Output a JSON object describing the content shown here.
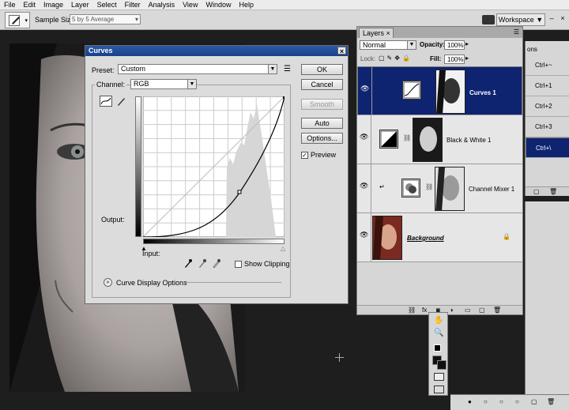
{
  "menu": [
    "File",
    "Edit",
    "Image",
    "Layer",
    "Select",
    "Filter",
    "Analysis",
    "View",
    "Window",
    "Help"
  ],
  "options_bar": {
    "sample_size_label": "Sample Size:",
    "sample_size_value": "5 by 5 Average",
    "workspace_label": "Workspace ▼"
  },
  "curves": {
    "title": "Curves",
    "preset_label": "Preset:",
    "preset_value": "Custom",
    "channel_label": "Channel:",
    "channel_value": "RGB",
    "output_label": "Output:",
    "input_label": "Input:",
    "show_clipping_label": "Show Clipping",
    "show_clipping_checked": false,
    "preview_label": "Preview",
    "preview_checked": true,
    "curve_display_options_label": "Curve Display Options",
    "buttons": {
      "ok": "OK",
      "cancel": "Cancel",
      "smooth": "Smooth",
      "auto": "Auto",
      "options": "Options..."
    }
  },
  "layers": {
    "tab_label": "Layers ×",
    "blend_mode": "Normal",
    "opacity_label": "Opacity:",
    "opacity_value": "100%",
    "lock_label": "Lock:",
    "fill_label": "Fill:",
    "fill_value": "100%",
    "items": [
      {
        "name": "Curves 1",
        "selected": true
      },
      {
        "name": "Black & White 1",
        "selected": false
      },
      {
        "name": "Channel Mixer 1",
        "selected": false
      },
      {
        "name": "Background",
        "selected": false
      }
    ]
  },
  "shortcuts": [
    {
      "label": "Ctrl+~",
      "selected": false
    },
    {
      "label": "Ctrl+1",
      "selected": false
    },
    {
      "label": "Ctrl+2",
      "selected": false
    },
    {
      "label": "Ctrl+3",
      "selected": false
    },
    {
      "label": "Ctrl+\\",
      "selected": true
    }
  ],
  "side_tab_fragment": "ons",
  "colors": {
    "selection": "#0e2470",
    "dialog_title": "#1f4b9a",
    "canvas_bg": "#1e1e1e"
  }
}
